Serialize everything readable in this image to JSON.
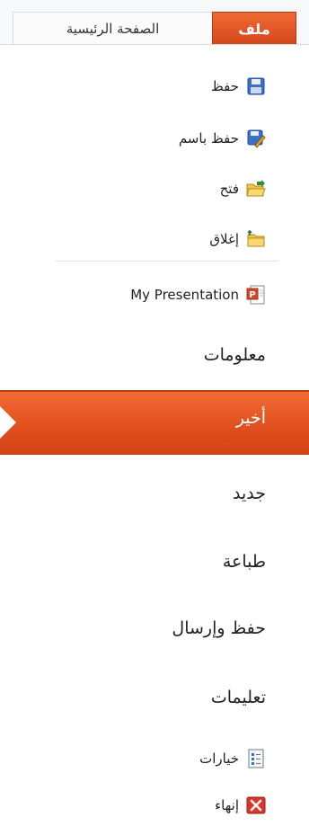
{
  "tabs": {
    "file": "ملف",
    "home": "الصفحة الرئيسية"
  },
  "quick_commands": [
    {
      "label": "حفظ",
      "icon": "save-icon"
    },
    {
      "label": "حفظ باسم",
      "icon": "save-as-icon"
    },
    {
      "label": "فتح",
      "icon": "open-folder-icon"
    },
    {
      "label": "إغلاق",
      "icon": "close-folder-icon"
    }
  ],
  "recent_document": {
    "label": "My Presentation",
    "icon": "powerpoint-file-icon"
  },
  "nav": {
    "info": "معلومات",
    "recent": "أخير",
    "new": "جديد",
    "print": "طباعة",
    "save_send": "حفظ وإرسال",
    "help": "تعليمات"
  },
  "bottom_commands": [
    {
      "label": "خيارات",
      "icon": "options-icon"
    },
    {
      "label": "إنهاء",
      "icon": "exit-icon"
    }
  ]
}
